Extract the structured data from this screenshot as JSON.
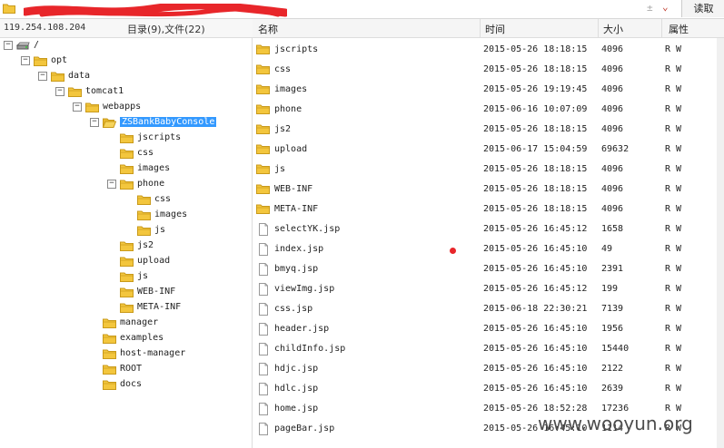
{
  "toolbar": {
    "plusminus": "±",
    "dropdown": "⌄",
    "read_label": "读取"
  },
  "info": {
    "ip": "119.254.108.204",
    "summary": "目录(9),文件(22)"
  },
  "columns": {
    "name": "名称",
    "time": "时间",
    "size": "大小",
    "attr": "属性"
  },
  "tree": [
    {
      "label": "/",
      "depth": 0,
      "toggle": "−",
      "icon": "drive-icon"
    },
    {
      "label": "opt",
      "depth": 1,
      "toggle": "−",
      "icon": "folder-icon"
    },
    {
      "label": "data",
      "depth": 2,
      "toggle": "−",
      "icon": "folder-icon"
    },
    {
      "label": "tomcat1",
      "depth": 3,
      "toggle": "−",
      "icon": "folder-icon"
    },
    {
      "label": "webapps",
      "depth": 4,
      "toggle": "−",
      "icon": "folder-icon"
    },
    {
      "label": "ZSBankBabyConsole",
      "depth": 5,
      "toggle": "−",
      "icon": "folder-open-icon",
      "selected": true
    },
    {
      "label": "jscripts",
      "depth": 6,
      "toggle": "",
      "icon": "folder-icon"
    },
    {
      "label": "css",
      "depth": 6,
      "toggle": "",
      "icon": "folder-icon"
    },
    {
      "label": "images",
      "depth": 6,
      "toggle": "",
      "icon": "folder-icon"
    },
    {
      "label": "phone",
      "depth": 6,
      "toggle": "−",
      "icon": "folder-icon"
    },
    {
      "label": "css",
      "depth": 7,
      "toggle": "",
      "icon": "folder-icon"
    },
    {
      "label": "images",
      "depth": 7,
      "toggle": "",
      "icon": "folder-icon"
    },
    {
      "label": "js",
      "depth": 7,
      "toggle": "",
      "icon": "folder-icon"
    },
    {
      "label": "js2",
      "depth": 6,
      "toggle": "",
      "icon": "folder-icon"
    },
    {
      "label": "upload",
      "depth": 6,
      "toggle": "",
      "icon": "folder-icon"
    },
    {
      "label": "js",
      "depth": 6,
      "toggle": "",
      "icon": "folder-icon"
    },
    {
      "label": "WEB-INF",
      "depth": 6,
      "toggle": "",
      "icon": "folder-icon"
    },
    {
      "label": "META-INF",
      "depth": 6,
      "toggle": "",
      "icon": "folder-icon"
    },
    {
      "label": "manager",
      "depth": 5,
      "toggle": "",
      "icon": "folder-icon"
    },
    {
      "label": "examples",
      "depth": 5,
      "toggle": "",
      "icon": "folder-icon"
    },
    {
      "label": "host-manager",
      "depth": 5,
      "toggle": "",
      "icon": "folder-icon"
    },
    {
      "label": "ROOT",
      "depth": 5,
      "toggle": "",
      "icon": "folder-icon"
    },
    {
      "label": "docs",
      "depth": 5,
      "toggle": "",
      "icon": "folder-icon"
    }
  ],
  "files": [
    {
      "name": "jscripts",
      "time": "2015-05-26 18:18:15",
      "size": "4096",
      "attr": "R W",
      "icon": "folder-icon"
    },
    {
      "name": "css",
      "time": "2015-05-26 18:18:15",
      "size": "4096",
      "attr": "R W",
      "icon": "folder-icon"
    },
    {
      "name": "images",
      "time": "2015-05-26 19:19:45",
      "size": "4096",
      "attr": "R W",
      "icon": "folder-icon"
    },
    {
      "name": "phone",
      "time": "2015-06-16 10:07:09",
      "size": "4096",
      "attr": "R W",
      "icon": "folder-icon"
    },
    {
      "name": "js2",
      "time": "2015-05-26 18:18:15",
      "size": "4096",
      "attr": "R W",
      "icon": "folder-icon"
    },
    {
      "name": "upload",
      "time": "2015-06-17 15:04:59",
      "size": "69632",
      "attr": "R W",
      "icon": "folder-icon"
    },
    {
      "name": "js",
      "time": "2015-05-26 18:18:15",
      "size": "4096",
      "attr": "R W",
      "icon": "folder-icon"
    },
    {
      "name": "WEB-INF",
      "time": "2015-05-26 18:18:15",
      "size": "4096",
      "attr": "R W",
      "icon": "folder-icon"
    },
    {
      "name": "META-INF",
      "time": "2015-05-26 18:18:15",
      "size": "4096",
      "attr": "R W",
      "icon": "folder-icon"
    },
    {
      "name": "selectYK.jsp",
      "time": "2015-05-26 16:45:12",
      "size": "1658",
      "attr": "R W",
      "icon": "file-icon"
    },
    {
      "name": "index.jsp",
      "time": "2015-05-26 16:45:10",
      "size": "49",
      "attr": "R W",
      "icon": "file-icon"
    },
    {
      "name": "bmyq.jsp",
      "time": "2015-05-26 16:45:10",
      "size": "2391",
      "attr": "R W",
      "icon": "file-icon"
    },
    {
      "name": "viewImg.jsp",
      "time": "2015-05-26 16:45:12",
      "size": "199",
      "attr": "R W",
      "icon": "file-icon"
    },
    {
      "name": "css.jsp",
      "time": "2015-06-18 22:30:21",
      "size": "7139",
      "attr": "R W",
      "icon": "file-icon"
    },
    {
      "name": "header.jsp",
      "time": "2015-05-26 16:45:10",
      "size": "1956",
      "attr": "R W",
      "icon": "file-icon"
    },
    {
      "name": "childInfo.jsp",
      "time": "2015-05-26 16:45:10",
      "size": "15440",
      "attr": "R W",
      "icon": "file-icon"
    },
    {
      "name": "hdjc.jsp",
      "time": "2015-05-26 16:45:10",
      "size": "2122",
      "attr": "R W",
      "icon": "file-icon"
    },
    {
      "name": "hdlc.jsp",
      "time": "2015-05-26 16:45:10",
      "size": "2639",
      "attr": "R W",
      "icon": "file-icon"
    },
    {
      "name": "home.jsp",
      "time": "2015-05-26 18:52:28",
      "size": "17236",
      "attr": "R W",
      "icon": "file-icon"
    },
    {
      "name": "pageBar.jsp",
      "time": "2015-05-26 16:45:10",
      "size": "1114",
      "attr": "R W",
      "icon": "file-icon"
    }
  ],
  "watermark": "www.wooyun.org",
  "colors": {
    "folder": "#f3c63d",
    "folder_edge": "#c99a1a",
    "selection": "#3399ff",
    "scribble": "#e8262a"
  }
}
